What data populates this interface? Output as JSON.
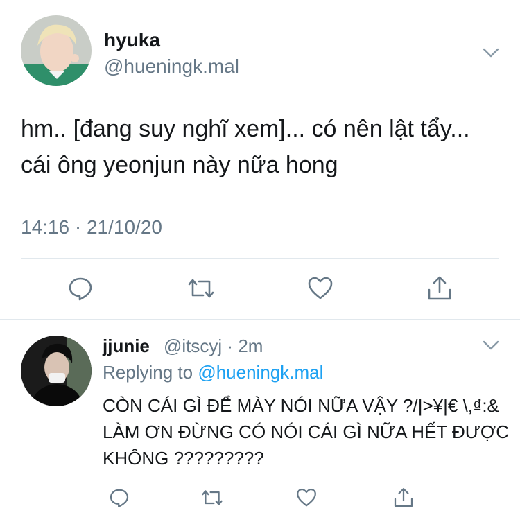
{
  "tweet": {
    "author_name": "hyuka",
    "author_handle": "@hueningk.mal",
    "text": "hm.. [đang suy nghĩ xem]... có nên lật tẩy... cái ông yeonjun này nữa hong",
    "time": "14:16",
    "separator": "·",
    "date": "21/10/20"
  },
  "reply": {
    "author_name": "jjunie",
    "author_handle": "@itscyj",
    "separator": "·",
    "age": "2m",
    "replying_label": "Replying to",
    "replying_handle": "@hueningk.mal",
    "text": "CÒN CÁI GÌ ĐỂ MÀY NÓI NỮA VẬY ?/|>¥|€ \\,₫:& LÀM ƠN ĐỪNG CÓ NÓI CÁI GÌ NỮA HẾT ĐƯỢC KHÔNG ?????????"
  },
  "icons": {
    "reply": "reply-icon",
    "retweet": "retweet-icon",
    "like": "heart-icon",
    "share": "share-icon",
    "more": "chevron-down-icon"
  },
  "colors": {
    "text": "#14171a",
    "secondary": "#657786",
    "accent": "#1da1f2",
    "divider": "#e1e8ed"
  }
}
